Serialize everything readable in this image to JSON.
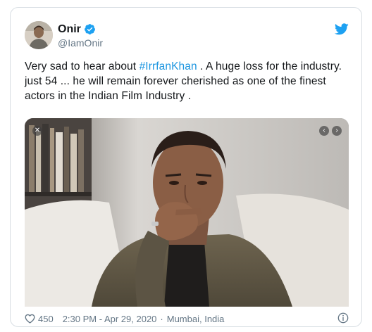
{
  "tweet": {
    "display_name": "Onir",
    "handle": "@IamOnir",
    "text_before_hashtag": "Very sad to hear about ",
    "hashtag": "#IrrfanKhan",
    "text_after_hashtag": " . A huge loss for the industry. just 54 ... he will remain forever cherished as one of the finest actors in the Indian Film Industry .",
    "media_icons": {
      "left": "close-carousel-icon",
      "right": "chevron-left-icon"
    }
  },
  "footer": {
    "likes": "450",
    "timestamp": "2:30 PM - Apr 29, 2020",
    "separator": "·",
    "location": "Mumbai, India"
  },
  "colors": {
    "link": "#1b95e0",
    "verified": "#1da1f2",
    "muted": "#657786",
    "border": "#d8dee3"
  },
  "icons": [
    "verified-badge-icon",
    "twitter-bird-icon",
    "heart-icon",
    "info-icon"
  ]
}
